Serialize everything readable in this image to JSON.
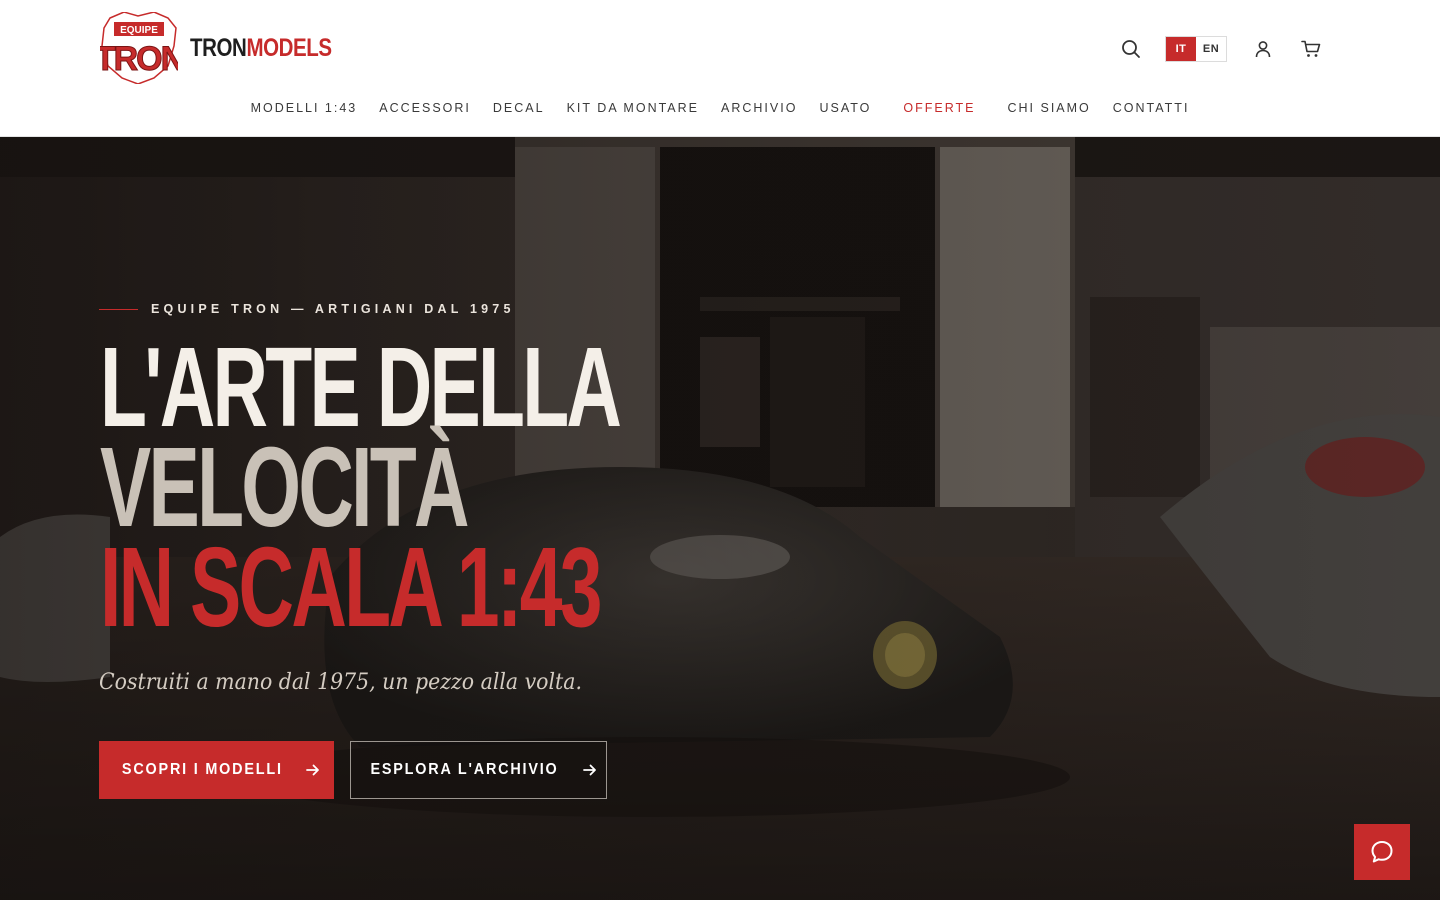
{
  "brand": {
    "logo_mark_top": "EQUIPE",
    "logo_mark_main": "TRON",
    "wordmark_part1": "TRON",
    "wordmark_part2": "MODELS"
  },
  "header_tools": {
    "search_icon": "search-icon",
    "languages": [
      {
        "code": "IT",
        "active": true
      },
      {
        "code": "EN",
        "active": false
      }
    ],
    "account_icon": "user-icon",
    "cart_icon": "cart-icon"
  },
  "nav": {
    "items": [
      {
        "label": "MODELLI 1:43"
      },
      {
        "label": "ACCESSORI"
      },
      {
        "label": "DECAL"
      },
      {
        "label": "KIT DA MONTARE"
      },
      {
        "label": "ARCHIVIO"
      },
      {
        "label": "USATO"
      },
      {
        "label": "OFFERTE",
        "highlight": true
      },
      {
        "label": "CHI SIAMO"
      },
      {
        "label": "CONTATTI"
      }
    ]
  },
  "hero": {
    "eyebrow": "EQUIPE TRON — ARTIGIANI DAL 1975",
    "headline_line1": "L'ARTE DELLA",
    "headline_line2": "VELOCITÀ",
    "headline_line3": "IN SCALA 1:43",
    "tagline": "Costruiti a mano dal 1975, un pezzo alla volta.",
    "cta_primary": "SCOPRI I MODELLI",
    "cta_secondary": "ESPLORA L'ARCHIVIO",
    "background": "dark garage with vintage race cars"
  },
  "chat": {
    "icon": "chat-bubble-icon"
  },
  "colors": {
    "accent": "#c62b2b",
    "header_bg": "#ffffff",
    "hero_text": "#f4efe8",
    "hero_text_muted": "#c9c1b7",
    "nav_text": "#3a3a3a"
  }
}
